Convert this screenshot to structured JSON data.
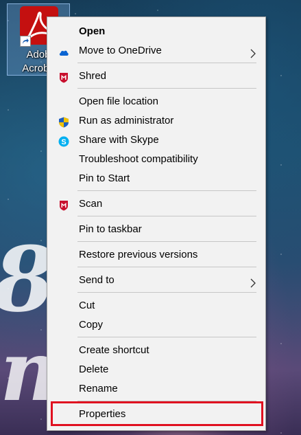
{
  "desktop": {
    "icon_label_line1": "Adob",
    "icon_label_line2": "Acroba",
    "icon_name": "adobe-acrobat-icon",
    "brand_color": "#c41010"
  },
  "menu": {
    "items": [
      {
        "label": "Open",
        "bold": true,
        "icon": null,
        "submenu": false
      },
      {
        "label": "Move to OneDrive",
        "icon": "onedrive-cloud-icon",
        "submenu": true
      },
      {
        "label": "Shred",
        "icon": "mcafee-shield-icon",
        "submenu": false
      },
      {
        "label": "Open file location",
        "icon": null,
        "submenu": false
      },
      {
        "label": "Run as administrator",
        "icon": "uac-shield-icon",
        "submenu": false
      },
      {
        "label": "Share with Skype",
        "icon": "skype-icon",
        "submenu": false
      },
      {
        "label": "Troubleshoot compatibility",
        "icon": null,
        "submenu": false
      },
      {
        "label": "Pin to Start",
        "icon": null,
        "submenu": false
      },
      {
        "label": "Scan",
        "icon": "mcafee-shield-icon",
        "submenu": false
      },
      {
        "label": "Pin to taskbar",
        "icon": null,
        "submenu": false
      },
      {
        "label": "Restore previous versions",
        "icon": null,
        "submenu": false
      },
      {
        "label": "Send to",
        "icon": null,
        "submenu": true
      },
      {
        "label": "Cut",
        "icon": null,
        "submenu": false
      },
      {
        "label": "Copy",
        "icon": null,
        "submenu": false
      },
      {
        "label": "Create shortcut",
        "icon": null,
        "submenu": false
      },
      {
        "label": "Delete",
        "icon": null,
        "submenu": false
      },
      {
        "label": "Rename",
        "icon": null,
        "submenu": false
      },
      {
        "label": "Properties",
        "icon": null,
        "submenu": false,
        "highlighted": true
      }
    ]
  },
  "colors": {
    "menu_bg": "#f2f2f2",
    "separator": "#c6c6c6",
    "highlight_border": "#e01020",
    "mcafee_red": "#c8102e",
    "onedrive_blue": "#0a64d2",
    "skype_blue": "#00aff0"
  }
}
